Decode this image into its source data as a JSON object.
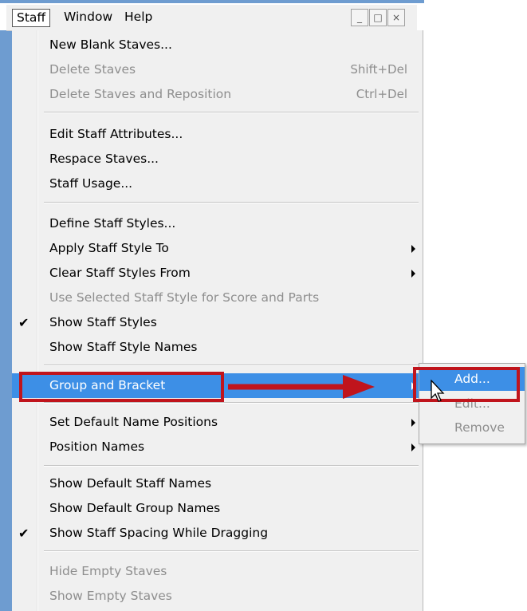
{
  "menubar": {
    "staff": "Staff",
    "window": "Window",
    "help": "Help",
    "window_controls": [
      "_",
      "□",
      "×"
    ]
  },
  "menu": {
    "items": [
      {
        "label": "New Blank Staves...",
        "enabled": true
      },
      {
        "label": "Delete Staves",
        "shortcut": "Shift+Del",
        "enabled": false
      },
      {
        "label": "Delete Staves and Reposition",
        "shortcut": "Ctrl+Del",
        "enabled": false
      },
      {
        "label": "Edit Staff Attributes...",
        "enabled": true
      },
      {
        "label": "Respace Staves...",
        "enabled": true
      },
      {
        "label": "Staff Usage...",
        "enabled": true
      },
      {
        "label": "Define Staff Styles...",
        "enabled": true
      },
      {
        "label": "Apply Staff Style To",
        "enabled": true,
        "submenu": true
      },
      {
        "label": "Clear Staff Styles From",
        "enabled": true,
        "submenu": true
      },
      {
        "label": "Use Selected Staff Style for Score and Parts",
        "enabled": false
      },
      {
        "label": "Show Staff Styles",
        "enabled": true,
        "checked": true
      },
      {
        "label": "Show Staff Style Names",
        "enabled": true
      },
      {
        "label": "Group and Bracket",
        "enabled": true,
        "submenu": true,
        "highlighted": true
      },
      {
        "label": "Set Default Name Positions",
        "enabled": true,
        "submenu": true
      },
      {
        "label": "Position Names",
        "enabled": true,
        "submenu": true
      },
      {
        "label": "Show Default Staff Names",
        "enabled": true
      },
      {
        "label": "Show Default Group Names",
        "enabled": true
      },
      {
        "label": "Show Staff Spacing While Dragging",
        "enabled": true,
        "checked": true
      },
      {
        "label": "Hide Empty Staves",
        "enabled": false
      },
      {
        "label": "Show Empty Staves",
        "enabled": false
      }
    ],
    "check_glyph": "✔"
  },
  "submenu": {
    "items": [
      {
        "label": "Add...",
        "enabled": true,
        "highlighted": true
      },
      {
        "label": "Edit...",
        "enabled": false
      },
      {
        "label": "Remove",
        "enabled": false
      }
    ]
  },
  "colors": {
    "highlight": "#3d8fe6",
    "annotation_red": "#c0141c",
    "menu_bg": "#f0f0f0"
  }
}
